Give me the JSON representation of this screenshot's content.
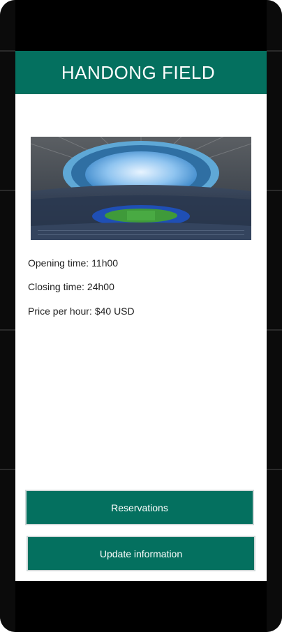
{
  "header": {
    "title": "HANDONG FIELD"
  },
  "details": {
    "opening_label": "Opening time:",
    "opening_value": "11h00",
    "closing_label": "Closing time:",
    "closing_value": "24h00",
    "price_label": "Price per hour:",
    "price_value": "$40 USD"
  },
  "buttons": {
    "reservations": "Reservations",
    "update": "Update information"
  },
  "colors": {
    "accent": "#04705f",
    "background": "#ffffff"
  },
  "image": {
    "icon": "stadium-photo"
  }
}
